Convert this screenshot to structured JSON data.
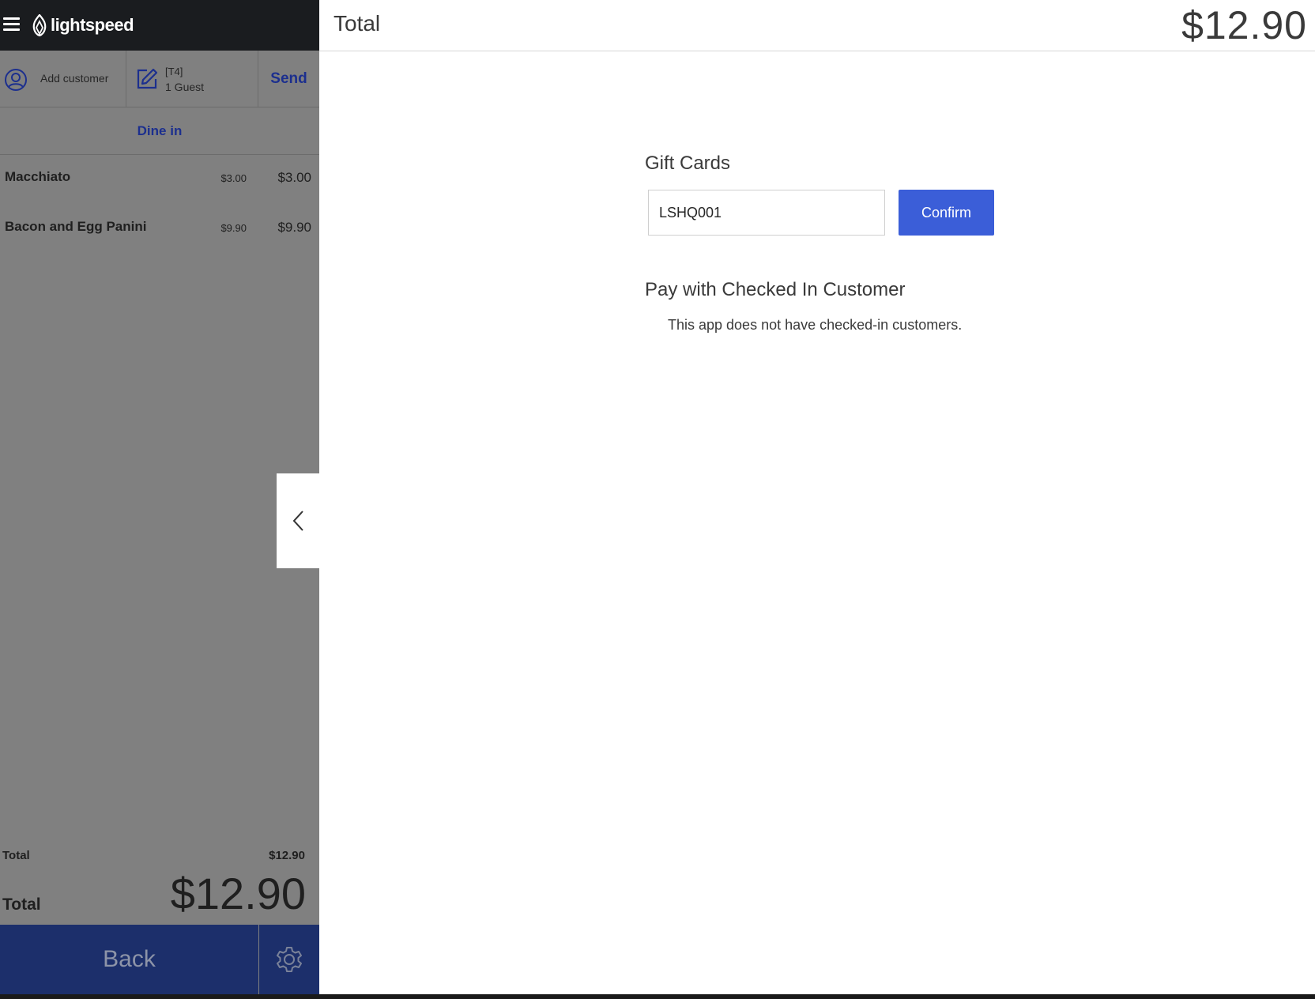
{
  "brand": {
    "name": "lightspeed"
  },
  "order_bar": {
    "add_customer": "Add customer",
    "table": "[T4]",
    "guests": "1 Guest",
    "send": "Send"
  },
  "service_mode": "Dine in",
  "items": [
    {
      "name": "Macchiato",
      "unit_price": "$3.00",
      "price": "$3.00"
    },
    {
      "name": "Bacon and Egg Panini",
      "unit_price": "$9.90",
      "price": "$9.90"
    }
  ],
  "summary": {
    "subtotal_label": "Total",
    "subtotal_value": "$12.90",
    "total_label": "Total",
    "total_value": "$12.90"
  },
  "footer": {
    "back": "Back"
  },
  "payment": {
    "header_title": "Total",
    "header_amount": "$12.90",
    "gift_cards_heading": "Gift Cards",
    "gift_card_value": "LSHQ001",
    "confirm": "Confirm",
    "checked_in_heading": "Pay with Checked In Customer",
    "checked_in_note": "This app does not have checked-in customers."
  },
  "colors": {
    "accent": "#3b5ed8",
    "nav_blue": "#1c2f8e",
    "footer_blue": "#1c2f6b",
    "topbar": "#1a1c1f",
    "overlay_grey": "#808080"
  }
}
